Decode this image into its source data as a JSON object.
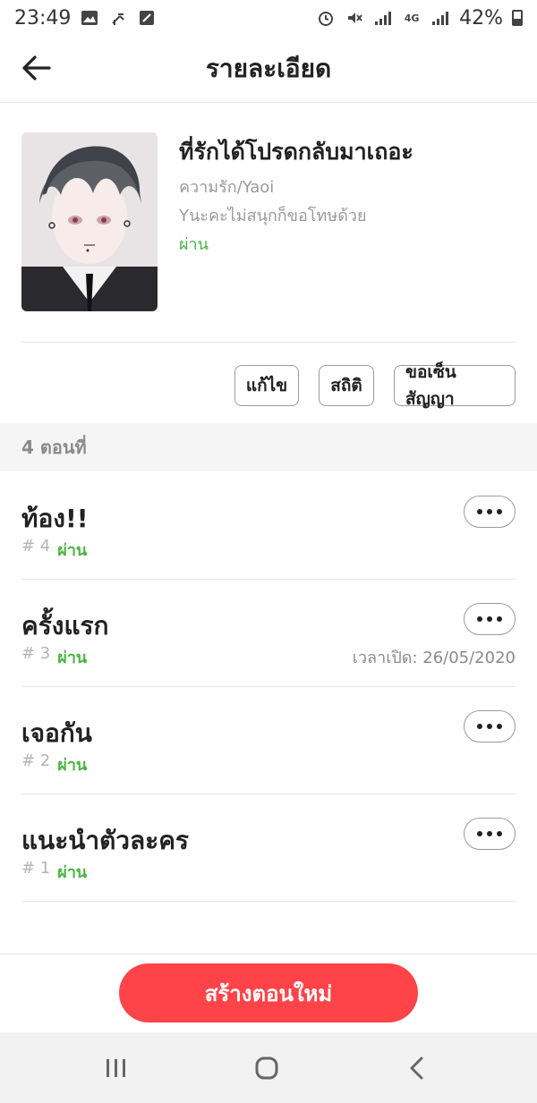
{
  "status_bar": {
    "time": "23:49",
    "battery": "42%",
    "icons_left": [
      "gallery-icon",
      "usb-icon",
      "app-icon"
    ],
    "icons_right": [
      "alarm-icon",
      "mute-icon",
      "signal-icon",
      "4g-icon",
      "signal-icon",
      "battery-icon"
    ]
  },
  "header": {
    "title": "รายละเอียด",
    "back_icon": "arrow-left-icon"
  },
  "book": {
    "title": "ที่รักได้โปรดกลับมาเถอะ",
    "genre": "ความรัก/Yaoi",
    "description": "Yนะคะไม่สนุกก็ขอโทษด้วย",
    "status": "ผ่าน"
  },
  "actions": {
    "edit": "แก้ไข",
    "stats": "สถิติ",
    "sign_contract": "ขอเซ็นสัญญา"
  },
  "episodes_header": "4 ตอนที่",
  "episodes": [
    {
      "title": "ท้อง!!",
      "number": "# 4",
      "status": "ผ่าน",
      "open_time": ""
    },
    {
      "title": "ครั้งแรก",
      "number": "# 3",
      "status": "ผ่าน",
      "open_time": "เวลาเปิด: 26/05/2020"
    },
    {
      "title": "เจอกัน",
      "number": "# 2",
      "status": "ผ่าน",
      "open_time": ""
    },
    {
      "title": "แนะนำตัวละคร",
      "number": "# 1",
      "status": "ผ่าน",
      "open_time": ""
    }
  ],
  "create_button": "สร้างตอนใหม่",
  "colors": {
    "accent": "#fe4449",
    "pass_green": "#4bb543",
    "muted": "#999999"
  },
  "nav_bar": {
    "icons": [
      "recents-icon",
      "home-icon",
      "back-icon"
    ]
  }
}
